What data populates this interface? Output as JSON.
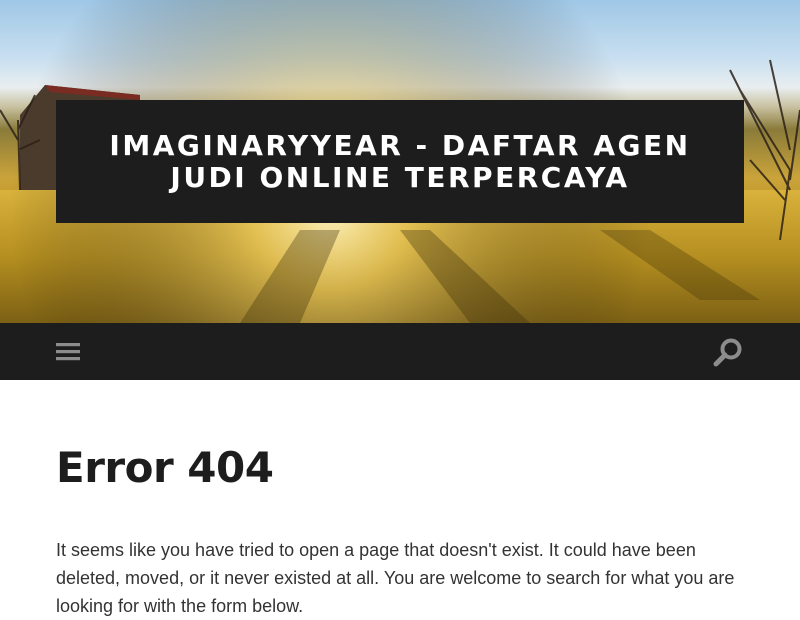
{
  "site": {
    "title": "ImaginaryYear - Daftar Agen Judi Online Terpercaya"
  },
  "nav": {
    "menu_icon": "hamburger-menu-icon",
    "search_icon": "search-icon"
  },
  "main": {
    "title": "Error 404",
    "text": "It seems like you have tried to open a page that doesn't exist. It could have been deleted, moved, or it never existed at all. You are welcome to search for what you are looking for with the form below."
  },
  "colors": {
    "dark": "#1d1d1d",
    "icon_gray": "#8c8c8c",
    "text": "#333333"
  }
}
